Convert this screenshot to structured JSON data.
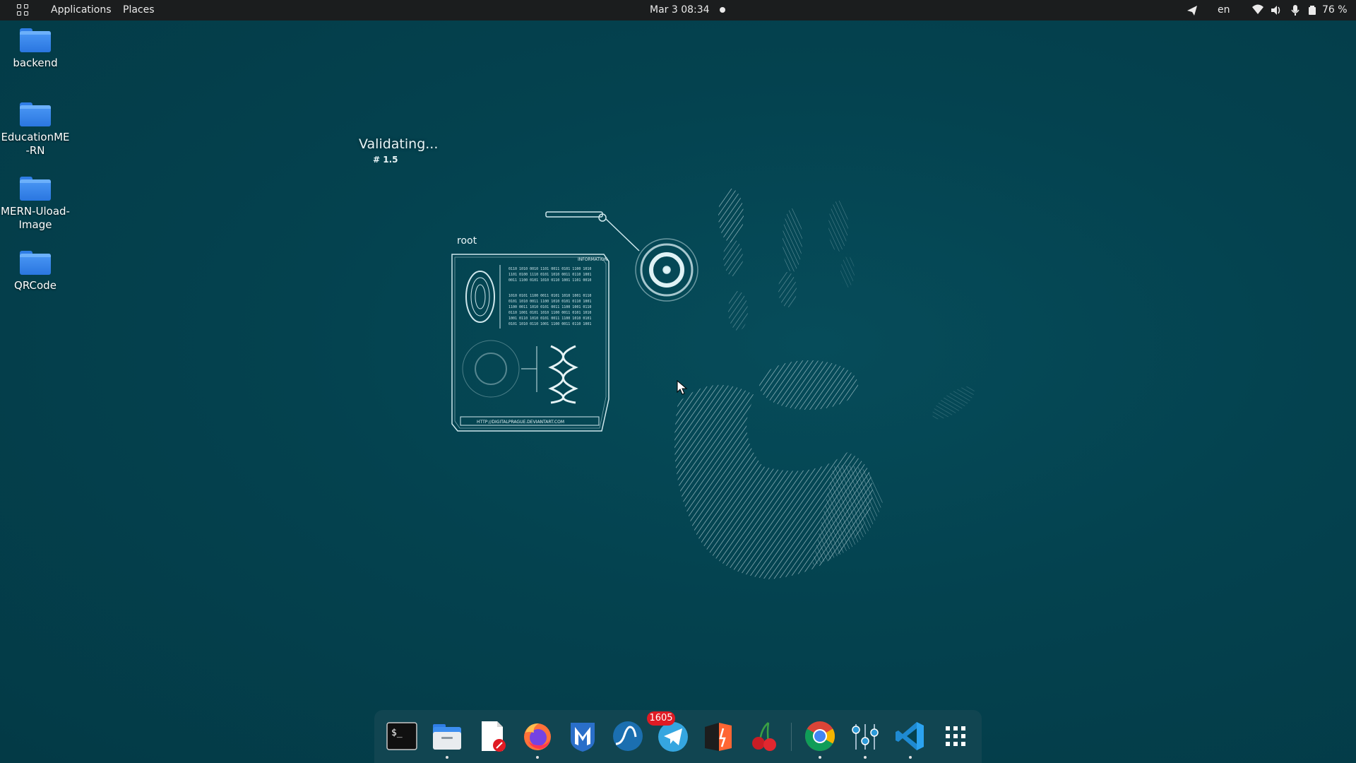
{
  "topbar": {
    "applications": "Applications",
    "places": "Places",
    "clock": "Mar 3  08:34",
    "language": "en",
    "battery": "76 %"
  },
  "desktop_icons": [
    {
      "label": "backend",
      "icon": "folder-icon"
    },
    {
      "label": "EducationME-RN",
      "icon": "folder-icon"
    },
    {
      "label": "MERN-Uload-Image",
      "icon": "folder-icon"
    },
    {
      "label": "QRCode",
      "icon": "folder-icon"
    }
  ],
  "wallpaper": {
    "status": "Validating...",
    "version": "# 1.5",
    "user": "root",
    "panel_header": "INFORMATION",
    "panel_url": "HTTP://DIGITALPRAGUE.DEVIANTART.COM"
  },
  "dock": {
    "badge_count": "1605",
    "apps": [
      {
        "name": "terminal",
        "icon": "terminal-icon",
        "running": false
      },
      {
        "name": "files",
        "icon": "files-icon",
        "running": true
      },
      {
        "name": "text-editor",
        "icon": "text-editor-icon",
        "running": false
      },
      {
        "name": "firefox",
        "icon": "firefox-icon",
        "running": true
      },
      {
        "name": "metasploit",
        "icon": "metasploit-icon",
        "running": false
      },
      {
        "name": "wireshark",
        "icon": "wireshark-icon",
        "running": false
      },
      {
        "name": "telegram",
        "icon": "telegram-icon",
        "running": false
      },
      {
        "name": "burp-suite",
        "icon": "burp-icon",
        "running": false
      },
      {
        "name": "cherrytree",
        "icon": "cherry-icon",
        "running": false
      },
      {
        "name": "chrome",
        "icon": "chrome-icon",
        "running": true
      },
      {
        "name": "settings",
        "icon": "tweaks-icon",
        "running": true
      },
      {
        "name": "vscode",
        "icon": "vscode-icon",
        "running": true
      },
      {
        "name": "show-apps",
        "icon": "grid-icon",
        "running": false
      }
    ]
  },
  "colors": {
    "desktop_bg": "#04424f",
    "topbar_bg": "#1b1d1e",
    "folder_blue": "#3b8af0",
    "badge_red": "#e01b24"
  }
}
